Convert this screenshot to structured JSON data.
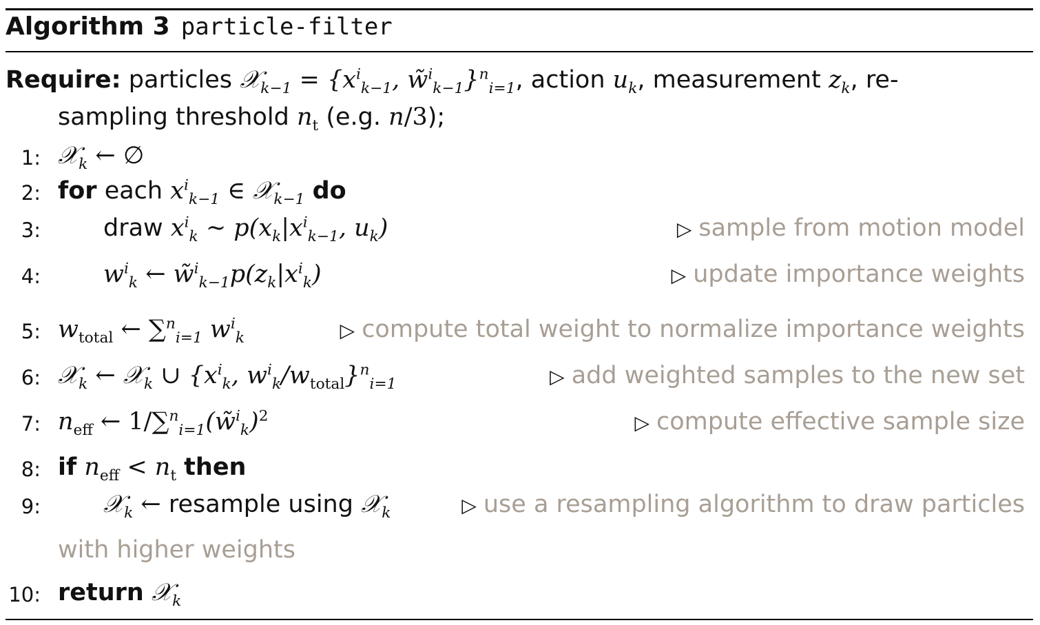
{
  "algorithm": {
    "label": "Algorithm 3",
    "name": "particle-filter"
  },
  "require": {
    "keyword": "Require:",
    "text_a": "particles",
    "text_b": ", action",
    "text_c": ", measurement",
    "text_d": ", re-",
    "text_e": "sampling threshold",
    "text_f": "(e.g.",
    "text_g": ");"
  },
  "lines": [
    {
      "n": "1:",
      "comment": ""
    },
    {
      "n": "2:",
      "kw_for": "for",
      "text_each": "each",
      "kw_do": "do",
      "comment": ""
    },
    {
      "n": "3:",
      "text_draw": "draw",
      "comment": "sample from motion model"
    },
    {
      "n": "4:",
      "comment": "update importance weights"
    },
    {
      "n": "5:",
      "comment": "compute total weight to normalize importance weights"
    },
    {
      "n": "6:",
      "comment": "add weighted samples to the new set"
    },
    {
      "n": "7:",
      "comment": "compute effective sample size"
    },
    {
      "n": "8:",
      "kw_if": "if",
      "kw_then": "then",
      "comment": ""
    },
    {
      "n": "9:",
      "text_resample": "resample using",
      "comment": "use a resampling algorithm to draw particles",
      "comment_cont": "with higher weights"
    },
    {
      "n": "10:",
      "kw_return": "return",
      "comment": ""
    }
  ],
  "comment_marker": "▷"
}
